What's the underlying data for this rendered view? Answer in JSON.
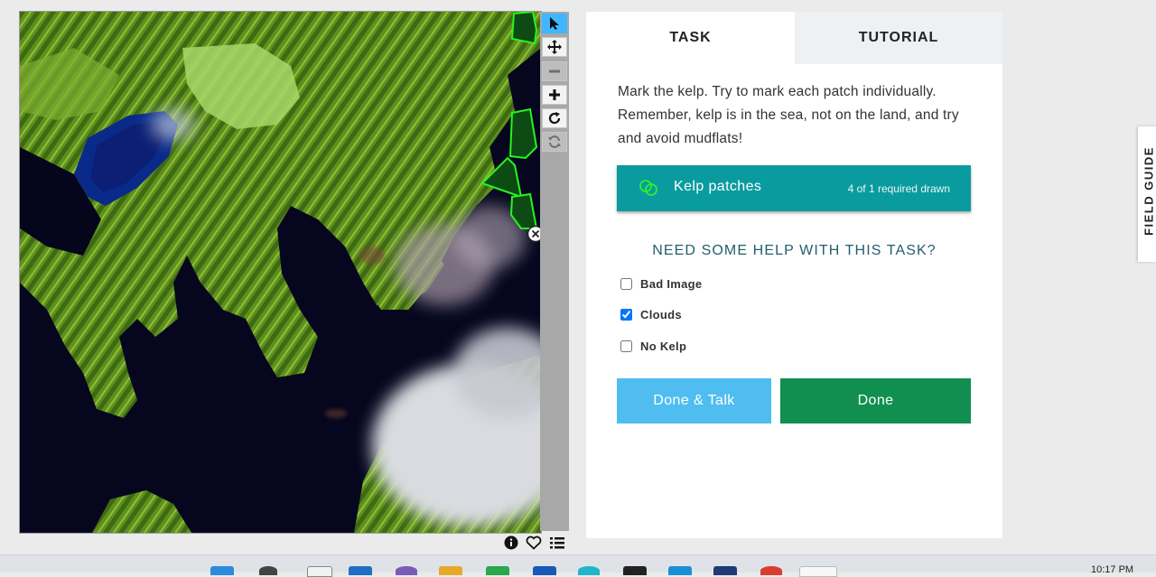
{
  "toolbar": {
    "tools": [
      {
        "name": "select-tool-button",
        "icon": "cursor-arrow-icon",
        "state": "active"
      },
      {
        "name": "pan-tool-button",
        "icon": "move-arrows-icon",
        "state": "normal"
      },
      {
        "name": "zoom-out-button",
        "icon": "minus-icon",
        "state": "disabled"
      },
      {
        "name": "zoom-in-button",
        "icon": "plus-icon",
        "state": "normal"
      },
      {
        "name": "rotate-button",
        "icon": "rotate-icon",
        "state": "normal"
      },
      {
        "name": "reset-button",
        "icon": "refresh-icon",
        "state": "disabled"
      }
    ]
  },
  "footer_icons": [
    "info-icon",
    "heart-icon",
    "list-icon"
  ],
  "tabs": {
    "task": "TASK",
    "tutorial": "TUTORIAL",
    "active": "task"
  },
  "task": {
    "instructions": "Mark the kelp. Try to mark each patch individually. Remember, kelp is in the sea, not on the land, and try and avoid mudflats!",
    "tool": {
      "label": "Kelp patches",
      "count_text": "4 of 1 required drawn",
      "icon": "polygon-shapes-icon",
      "color": "#0a9b9f"
    },
    "help_heading": "NEED SOME HELP WITH THIS TASK?",
    "checkboxes": [
      {
        "label": "Bad Image",
        "checked": false
      },
      {
        "label": "Clouds",
        "checked": true
      },
      {
        "label": "No Kelp",
        "checked": false
      }
    ],
    "done_talk_label": "Done & Talk",
    "done_label": "Done"
  },
  "field_guide_label": "FIELD GUIDE",
  "colors": {
    "done_talk": "#4fbdf0",
    "done": "#108f50",
    "active_tool": "#3fb6ff",
    "heading": "#245e6d"
  },
  "taskbar": {
    "clock": "10:17 PM"
  }
}
